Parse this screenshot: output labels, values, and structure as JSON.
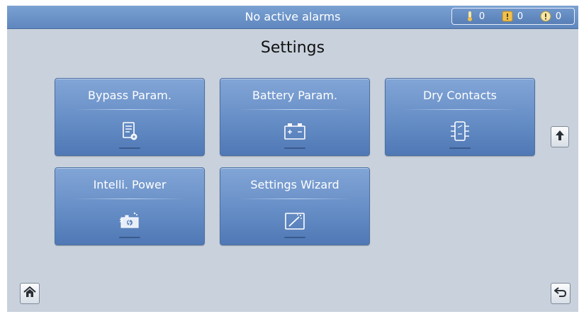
{
  "status_bar": {
    "alarm_message": "No active alarms",
    "counters": [
      {
        "icon": "critical-alarm-icon",
        "count": "0"
      },
      {
        "icon": "major-alarm-icon",
        "count": "0"
      },
      {
        "icon": "minor-alarm-icon",
        "count": "0"
      }
    ]
  },
  "page": {
    "title": "Settings"
  },
  "tiles": [
    {
      "label": "Bypass Param.",
      "icon": "bypass-param-icon"
    },
    {
      "label": "Battery Param.",
      "icon": "battery-icon"
    },
    {
      "label": "Dry Contacts",
      "icon": "dry-contacts-icon"
    },
    {
      "label": "Intelli. Power",
      "icon": "intelli-power-icon"
    },
    {
      "label": "Settings Wizard",
      "icon": "wizard-icon"
    }
  ],
  "nav": {
    "scroll_up": "arrow-up-icon",
    "home": "home-icon",
    "back": "back-icon"
  },
  "colors": {
    "status_bar": "#6b92c9",
    "background": "#c8d1dc",
    "tile": "#6b92c9",
    "tile_border": "#4c6fa2"
  }
}
